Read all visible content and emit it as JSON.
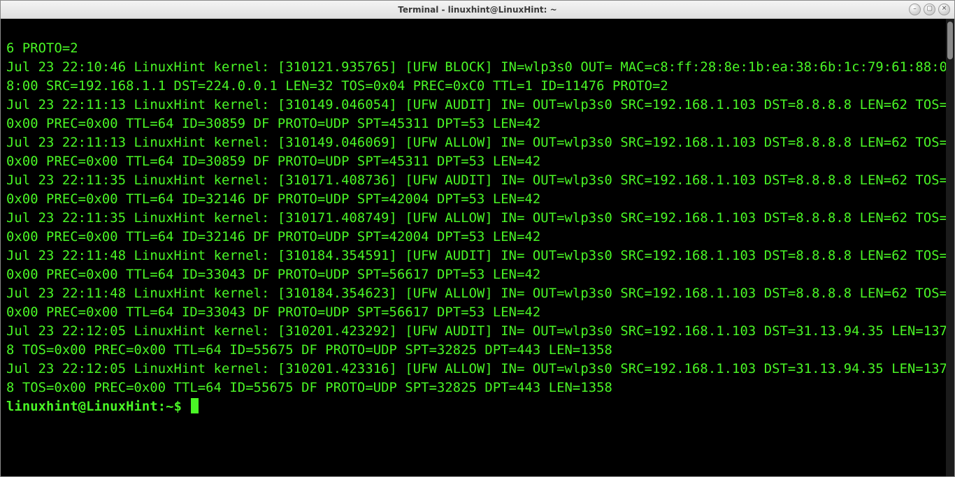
{
  "window": {
    "title": "Terminal - linuxhint@LinuxHint: ~"
  },
  "titlebar_buttons": {
    "minimize": "–",
    "maximize": "▢",
    "close": "✕"
  },
  "colors": {
    "terminal_bg": "#000000",
    "terminal_fg": "#4af626"
  },
  "log_lines": [
    "6 PROTO=2",
    "Jul 23 22:10:46 LinuxHint kernel: [310121.935765] [UFW BLOCK] IN=wlp3s0 OUT= MAC=c8:ff:28:8e:1b:ea:38:6b:1c:79:61:88:08:00 SRC=192.168.1.1 DST=224.0.0.1 LEN=32 TOS=0x04 PREC=0xC0 TTL=1 ID=11476 PROTO=2",
    "Jul 23 22:11:13 LinuxHint kernel: [310149.046054] [UFW AUDIT] IN= OUT=wlp3s0 SRC=192.168.1.103 DST=8.8.8.8 LEN=62 TOS=0x00 PREC=0x00 TTL=64 ID=30859 DF PROTO=UDP SPT=45311 DPT=53 LEN=42",
    "Jul 23 22:11:13 LinuxHint kernel: [310149.046069] [UFW ALLOW] IN= OUT=wlp3s0 SRC=192.168.1.103 DST=8.8.8.8 LEN=62 TOS=0x00 PREC=0x00 TTL=64 ID=30859 DF PROTO=UDP SPT=45311 DPT=53 LEN=42",
    "Jul 23 22:11:35 LinuxHint kernel: [310171.408736] [UFW AUDIT] IN= OUT=wlp3s0 SRC=192.168.1.103 DST=8.8.8.8 LEN=62 TOS=0x00 PREC=0x00 TTL=64 ID=32146 DF PROTO=UDP SPT=42004 DPT=53 LEN=42",
    "Jul 23 22:11:35 LinuxHint kernel: [310171.408749] [UFW ALLOW] IN= OUT=wlp3s0 SRC=192.168.1.103 DST=8.8.8.8 LEN=62 TOS=0x00 PREC=0x00 TTL=64 ID=32146 DF PROTO=UDP SPT=42004 DPT=53 LEN=42",
    "Jul 23 22:11:48 LinuxHint kernel: [310184.354591] [UFW AUDIT] IN= OUT=wlp3s0 SRC=192.168.1.103 DST=8.8.8.8 LEN=62 TOS=0x00 PREC=0x00 TTL=64 ID=33043 DF PROTO=UDP SPT=56617 DPT=53 LEN=42",
    "Jul 23 22:11:48 LinuxHint kernel: [310184.354623] [UFW ALLOW] IN= OUT=wlp3s0 SRC=192.168.1.103 DST=8.8.8.8 LEN=62 TOS=0x00 PREC=0x00 TTL=64 ID=33043 DF PROTO=UDP SPT=56617 DPT=53 LEN=42",
    "Jul 23 22:12:05 LinuxHint kernel: [310201.423292] [UFW AUDIT] IN= OUT=wlp3s0 SRC=192.168.1.103 DST=31.13.94.35 LEN=1378 TOS=0x00 PREC=0x00 TTL=64 ID=55675 DF PROTO=UDP SPT=32825 DPT=443 LEN=1358",
    "Jul 23 22:12:05 LinuxHint kernel: [310201.423316] [UFW ALLOW] IN= OUT=wlp3s0 SRC=192.168.1.103 DST=31.13.94.35 LEN=1378 TOS=0x00 PREC=0x00 TTL=64 ID=55675 DF PROTO=UDP SPT=32825 DPT=443 LEN=1358"
  ],
  "prompt": {
    "user_host": "linuxhint@LinuxHint",
    "sep": ":",
    "path": "~",
    "symbol": "$"
  }
}
